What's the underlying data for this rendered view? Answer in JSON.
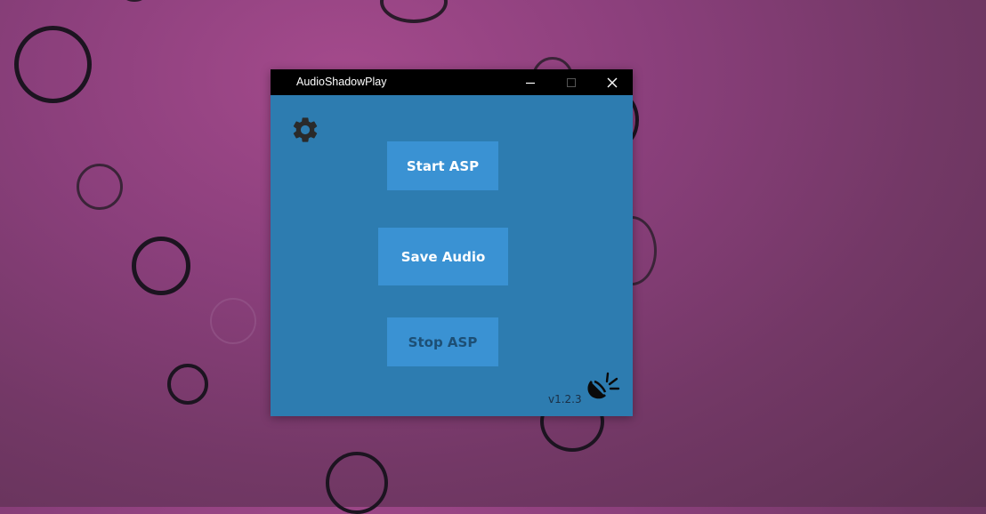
{
  "window": {
    "title": "AudioShadowPlay",
    "controls": {
      "minimize": "minimize-icon",
      "maximize": "maximize-icon",
      "close": "close-icon"
    }
  },
  "toolbar": {
    "settings_icon": "gear-icon"
  },
  "actions": {
    "start_label": "Start ASP",
    "save_label": "Save Audio",
    "stop_label": "Stop ASP"
  },
  "footer": {
    "version": "v1.2.3",
    "logo_icon": "speaker-shadow-icon"
  },
  "colors": {
    "titlebar": "#000000",
    "window_background": "#2d7cb0",
    "button_background": "#3a92d3",
    "button_text": "#ffffff",
    "stop_text": "#1d4f75",
    "desktop_background": "#8a3f7b"
  }
}
